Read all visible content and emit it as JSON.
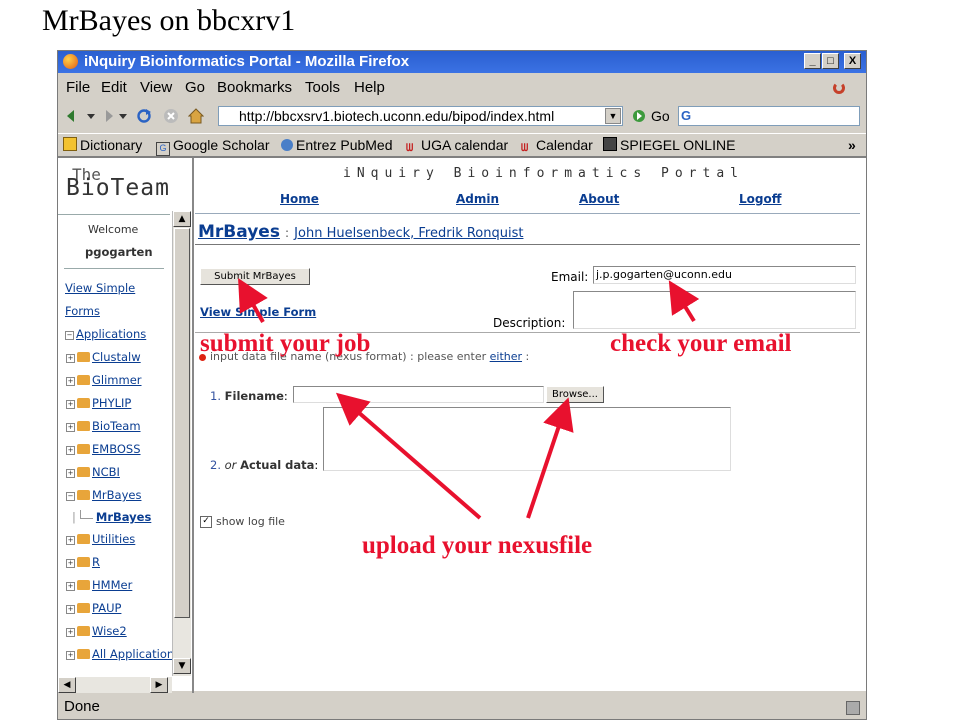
{
  "slide": {
    "title": "MrBayes on bbcxrv1"
  },
  "browser": {
    "window_title": "iNquiry Bioinformatics Portal - Mozilla Firefox",
    "window_buttons": [
      "_",
      "□",
      "X"
    ],
    "menu": [
      "File",
      "Edit",
      "View",
      "Go",
      "Bookmarks",
      "Tools",
      "Help"
    ],
    "url": "http://bbcxsrv1.biotech.uconn.edu/bipod/index.html",
    "go_label": "Go",
    "search_engine_glyph": "G",
    "bookmarks": [
      "Dictionary",
      "Google Scholar",
      "Entrez PubMed",
      "UGA calendar",
      "Calendar",
      "SPIEGEL ONLINE"
    ],
    "bookmarks_overflow": "»",
    "status": "Done"
  },
  "portal": {
    "logo_top": "The",
    "logo_main": "BioTeam",
    "title": "iNquiry Bioinformatics Portal",
    "nav": [
      "Home",
      "Admin",
      "About",
      "Logoff"
    ]
  },
  "sidebar": {
    "welcome": "Welcome",
    "user": "pgogarten",
    "view_simple": "View Simple",
    "forms": "Forms",
    "applications": "Applications",
    "tree": [
      "Clustalw",
      "Glimmer",
      "PHYLIP",
      "BioTeam",
      "EMBOSS",
      "NCBI",
      "MrBayes"
    ],
    "tree_child": "MrBayes",
    "tree_after": [
      "Utilities",
      "R",
      "HMMer",
      "PAUP",
      "Wise2",
      "All Application"
    ]
  },
  "form": {
    "tool_name": "MrBayes",
    "tool_sep": ":",
    "authors": "John Huelsenbeck, Fredrik Ronquist",
    "submit_label": "Submit MrBayes",
    "email_label": "Email:",
    "email_value": "j.p.gogarten@uconn.edu",
    "view_simple_form": "View Simple Form",
    "description_label": "Description:",
    "input_prompt_pre": "input data file name (nexus format) : please enter ",
    "input_prompt_link": "either",
    "input_prompt_post": " :",
    "filename_num": "1.",
    "filename_label": "Filename",
    "filename_colon": ":",
    "browse_label": "Browse...",
    "actual_num": "2.",
    "actual_or": "or",
    "actual_label": "Actual data",
    "actual_colon": ":",
    "show_log": "show log file",
    "show_log_checked": true
  },
  "annotations": {
    "submit": "submit your job",
    "email": "check your email",
    "upload": "upload your nexusfile",
    "color": "#e8112e"
  }
}
